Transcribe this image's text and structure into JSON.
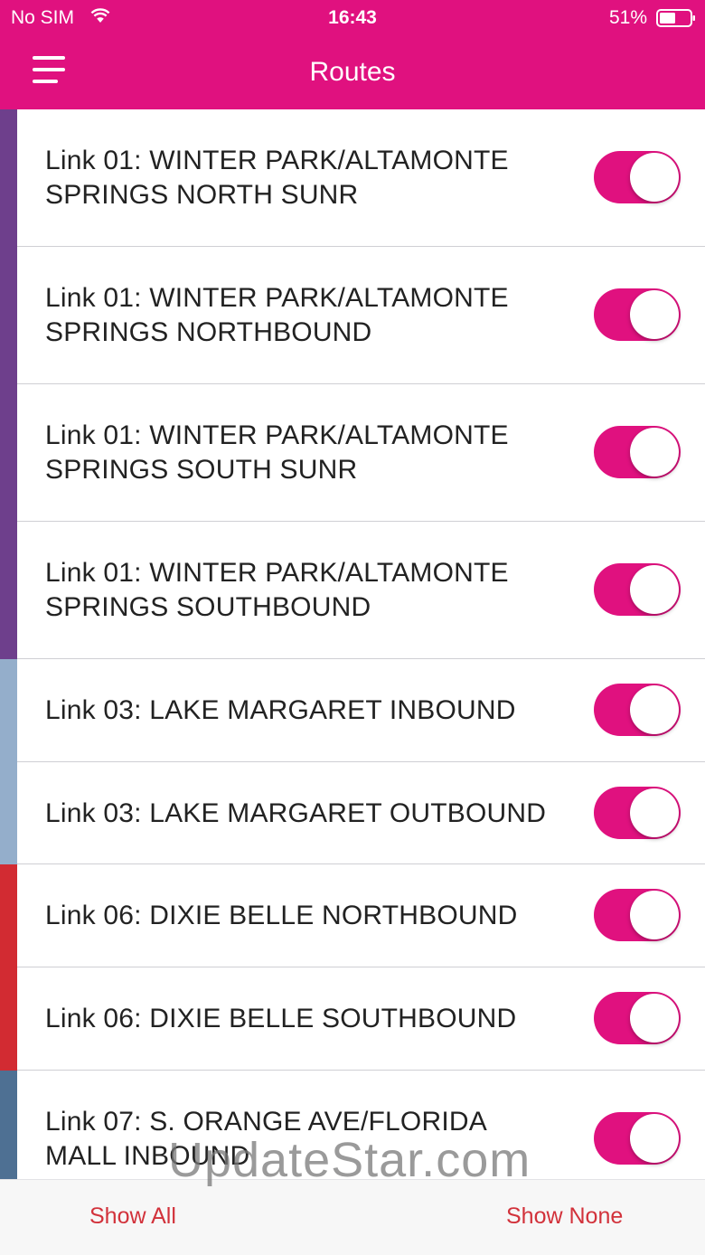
{
  "status_bar": {
    "carrier": "No SIM",
    "time": "16:43",
    "battery": "51%"
  },
  "header": {
    "title": "Routes"
  },
  "routes": [
    {
      "line1": "Link 01: WINTER PARK/ALTAMONTE",
      "line2": "SPRINGS NORTH SUNR",
      "color": "#6E3F8C",
      "enabled": true
    },
    {
      "line1": "Link 01: WINTER PARK/ALTAMONTE",
      "line2": "SPRINGS NORTHBOUND",
      "color": "#6E3F8C",
      "enabled": true
    },
    {
      "line1": "Link 01: WINTER PARK/ALTAMONTE",
      "line2": "SPRINGS SOUTH SUNR",
      "color": "#6E3F8C",
      "enabled": true
    },
    {
      "line1": "Link 01: WINTER PARK/ALTAMONTE",
      "line2": "SPRINGS SOUTHBOUND",
      "color": "#6E3F8C",
      "enabled": true
    },
    {
      "line1": "Link 03: LAKE MARGARET INBOUND",
      "line2": "",
      "color": "#94AECB",
      "enabled": true
    },
    {
      "line1": "Link 03: LAKE MARGARET OUTBOUND",
      "line2": "",
      "color": "#94AECB",
      "enabled": true
    },
    {
      "line1": "Link 06: DIXIE BELLE NORTHBOUND",
      "line2": "",
      "color": "#D22B32",
      "enabled": true
    },
    {
      "line1": "Link 06: DIXIE BELLE SOUTHBOUND",
      "line2": "",
      "color": "#D22B32",
      "enabled": true
    },
    {
      "line1": "Link 07: S. ORANGE AVE/FLORIDA",
      "line2": "MALL INBOUND",
      "color": "#4E7093",
      "enabled": true
    }
  ],
  "footer": {
    "show_all": "Show All",
    "show_none": "Show None"
  },
  "watermark": "UpdateStar.com",
  "colors": {
    "accent": "#E0117F",
    "footer_text": "#D2323B"
  }
}
